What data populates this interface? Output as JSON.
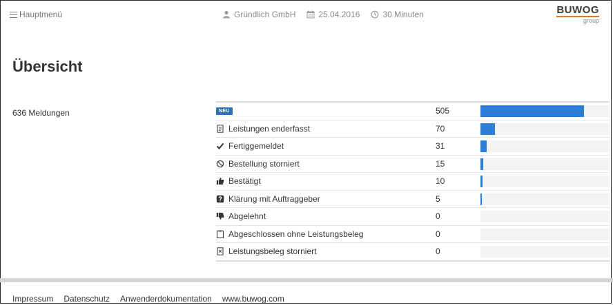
{
  "header": {
    "menu_label": "Hauptmenü",
    "company": "Gründlich GmbH",
    "date": "25.04.2016",
    "duration": "30 Minuten",
    "logo_text": "BUWOG",
    "logo_sub": "group",
    "logo_accent": "#e8731a"
  },
  "main": {
    "title": "Übersicht",
    "count_label": "636 Meldungen"
  },
  "status_rows": [
    {
      "label": "NEU",
      "badge": true,
      "icon": "new-badge",
      "value": 505,
      "ratio": 0.8
    },
    {
      "label": "Leistungen enderfasst",
      "icon": "document-check-icon",
      "value": 70,
      "ratio": 0.11
    },
    {
      "label": "Fertiggemeldet",
      "icon": "checkmark-icon",
      "value": 31,
      "ratio": 0.05
    },
    {
      "label": "Bestellung storniert",
      "icon": "ban-icon",
      "value": 15,
      "ratio": 0.02
    },
    {
      "label": "Bestätigt",
      "icon": "thumbs-up-icon",
      "value": 10,
      "ratio": 0.015
    },
    {
      "label": "Klärung mit Auftraggeber",
      "icon": "question-icon",
      "value": 5,
      "ratio": 0.008
    },
    {
      "label": "Abgelehnt",
      "icon": "thumbs-down-icon",
      "value": 0,
      "ratio": 0
    },
    {
      "label": "Abgeschlossen ohne Leistungsbeleg",
      "icon": "clipboard-icon",
      "value": 0,
      "ratio": 0
    },
    {
      "label": "Leistungsbeleg storniert",
      "icon": "document-x-icon",
      "value": 0,
      "ratio": 0
    }
  ],
  "bar_color": "#2d7fd6",
  "footer": {
    "links": [
      "Impressum",
      "Datenschutz",
      "Anwenderdokumentation",
      "www.buwog.com"
    ]
  }
}
